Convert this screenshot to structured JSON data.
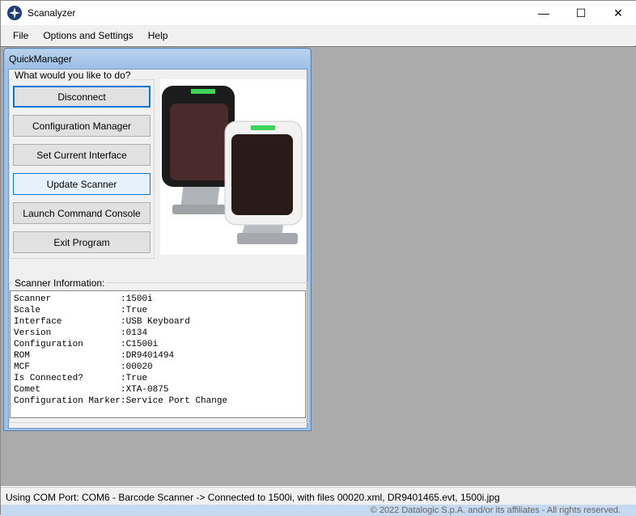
{
  "app": {
    "title": "Scanalyzer"
  },
  "menu": [
    "File",
    "Options and Settings",
    "Help"
  ],
  "child": {
    "title": "QuickManager",
    "group_label": "What would you like to do?",
    "buttons": [
      "Disconnect",
      "Configuration Manager",
      "Set Current Interface",
      "Update Scanner",
      "Launch Command Console",
      "Exit Program"
    ],
    "info_label": "Scanner Information:",
    "info": [
      [
        "Scanner",
        "1500i"
      ],
      [
        "Scale",
        "True"
      ],
      [
        "Interface",
        "USB Keyboard"
      ],
      [
        "Version",
        "0134"
      ],
      [
        "Configuration",
        "C1500i"
      ],
      [
        "ROM",
        "DR9401494"
      ],
      [
        "MCF",
        "00020"
      ],
      [
        "Is Connected?",
        "True"
      ],
      [
        "Comet",
        "XTA-0875"
      ],
      [
        "Configuration Marker",
        "Service Port Change"
      ]
    ]
  },
  "status": "Using COM Port: COM6 - Barcode Scanner -> Connected to 1500i, with files 00020.xml, DR9401465.evt, 1500i.jpg",
  "copyright": "© 2022 Datalogic S.p.A. and/or its affiliates - All rights reserved."
}
